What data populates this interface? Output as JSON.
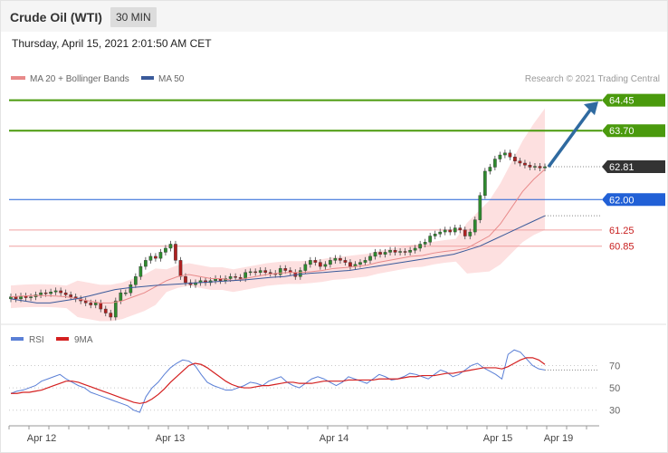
{
  "header": {
    "title": "Crude Oil (WTI)",
    "timeframe": "30 MIN",
    "date": "Thursday, April 15, 2021 2:01:50 AM CET"
  },
  "legend": {
    "ma20": "MA 20 + Bollinger Bands",
    "ma50": "MA 50",
    "copyright": "Research © 2021 Trading Central"
  },
  "colors": {
    "green": "#4a9a0d",
    "blue": "#2160d6",
    "red_line": "#f0a0a0",
    "red_text": "#c81e1e",
    "ma20": "#e88a8a",
    "ma50": "#3a5a9a",
    "band": "#fde0e0",
    "rsi": "#5a7fd6",
    "rsi_ma": "#d42020",
    "arrow": "#2f6aa0"
  },
  "chart_data": [
    {
      "type": "line",
      "title": "",
      "x_ticks": [
        "Apr 12",
        "Apr 13",
        "Apr 14",
        "Apr 15",
        "Apr 19"
      ],
      "ylim": [
        59.1,
        64.8
      ],
      "levels": [
        {
          "value": 64.45,
          "label": "64.45",
          "style": "resistance"
        },
        {
          "value": 63.7,
          "label": "63.70",
          "style": "resistance"
        },
        {
          "value": 62.81,
          "label": "62.81",
          "style": "last-price"
        },
        {
          "value": 62.0,
          "label": "62.00",
          "style": "pivot"
        },
        {
          "value": 61.25,
          "label": "61.25",
          "style": "support"
        },
        {
          "value": 60.85,
          "label": "60.85",
          "style": "support"
        }
      ],
      "price_close": [
        59.6,
        59.55,
        59.62,
        59.58,
        59.6,
        59.65,
        59.7,
        59.68,
        59.72,
        59.75,
        59.7,
        59.65,
        59.6,
        59.55,
        59.5,
        59.45,
        59.4,
        59.45,
        59.3,
        59.2,
        59.1,
        59.5,
        59.7,
        59.7,
        59.9,
        60.1,
        60.35,
        60.5,
        60.6,
        60.55,
        60.7,
        60.8,
        60.9,
        60.5,
        60.1,
        59.95,
        59.9,
        59.95,
        60.0,
        59.95,
        60.0,
        60.05,
        60.0,
        60.05,
        60.1,
        60.08,
        60.05,
        60.2,
        60.22,
        60.2,
        60.25,
        60.2,
        60.18,
        60.15,
        60.3,
        60.25,
        60.2,
        60.1,
        60.25,
        60.4,
        60.5,
        60.45,
        60.35,
        60.4,
        60.5,
        60.55,
        60.5,
        60.45,
        60.35,
        60.4,
        60.45,
        60.5,
        60.6,
        60.7,
        60.65,
        60.7,
        60.75,
        60.7,
        60.72,
        60.7,
        60.75,
        60.8,
        60.9,
        60.95,
        61.1,
        61.15,
        61.2,
        61.25,
        61.2,
        61.3,
        61.25,
        61.1,
        61.2,
        61.5,
        62.1,
        62.7,
        62.8,
        63.0,
        63.1,
        63.15,
        63.05,
        62.95,
        62.9,
        62.85,
        62.8,
        62.82,
        62.78,
        62.81
      ],
      "ma20": [
        59.6,
        59.62,
        59.63,
        59.63,
        59.62,
        59.6,
        59.55,
        59.5,
        59.45,
        59.45,
        59.5,
        59.6,
        59.7,
        59.85,
        60.0,
        60.1,
        60.15,
        60.1,
        60.05,
        60.05,
        60.0,
        60.05,
        60.1,
        60.15,
        60.18,
        60.2,
        60.2,
        60.22,
        60.25,
        60.3,
        60.32,
        60.35,
        60.38,
        60.45,
        60.5,
        60.55,
        60.6,
        60.62,
        60.68,
        60.72,
        60.75,
        60.8,
        60.95,
        61.1,
        61.4,
        61.8,
        62.2,
        62.5,
        62.75
      ],
      "ma50": [
        59.55,
        59.5,
        59.45,
        59.45,
        59.5,
        59.55,
        59.62,
        59.7,
        59.78,
        59.82,
        59.85,
        59.88,
        59.9,
        59.92,
        59.94,
        59.96,
        59.98,
        60.0,
        60.02,
        60.05,
        60.08,
        60.1,
        60.15,
        60.18,
        60.2,
        60.23,
        60.25,
        60.3,
        60.35,
        60.4,
        60.45,
        60.5,
        60.55,
        60.6,
        60.65,
        60.75,
        60.85,
        61.0,
        61.15,
        61.3,
        61.45,
        61.6
      ]
    },
    {
      "type": "line",
      "title": "RSI",
      "ylim": [
        20,
        85
      ],
      "y_ticks": [
        "70",
        "50",
        "30"
      ],
      "series": [
        {
          "name": "RSI",
          "values": [
            45,
            47,
            48,
            50,
            52,
            56,
            58,
            60,
            62,
            58,
            55,
            52,
            50,
            46,
            44,
            42,
            40,
            38,
            36,
            34,
            30,
            28,
            42,
            50,
            55,
            62,
            68,
            72,
            75,
            74,
            70,
            62,
            55,
            52,
            50,
            48,
            48,
            50,
            52,
            55,
            54,
            52,
            56,
            58,
            60,
            55,
            52,
            50,
            54,
            58,
            60,
            58,
            55,
            52,
            55,
            60,
            58,
            56,
            54,
            58,
            62,
            60,
            57,
            58,
            60,
            63,
            62,
            60,
            58,
            62,
            66,
            64,
            60,
            62,
            66,
            70,
            72,
            68,
            65,
            62,
            58,
            80,
            84,
            82,
            76,
            70,
            67,
            66
          ]
        },
        {
          "name": "9MA",
          "values": [
            45,
            45,
            46,
            46,
            47,
            48,
            50,
            52,
            54,
            56,
            56,
            55,
            53,
            51,
            49,
            47,
            45,
            43,
            41,
            39,
            37,
            36,
            37,
            40,
            44,
            49,
            55,
            60,
            65,
            70,
            72,
            71,
            68,
            64,
            60,
            56,
            53,
            51,
            50,
            50,
            51,
            52,
            52,
            53,
            54,
            55,
            55,
            54,
            54,
            54,
            55,
            56,
            56,
            56,
            56,
            57,
            57,
            57,
            57,
            57,
            58,
            58,
            58,
            58,
            59,
            60,
            60,
            61,
            61,
            61,
            62,
            63,
            63,
            64,
            65,
            66,
            67,
            68,
            68,
            68,
            67,
            69,
            72,
            75,
            77,
            77,
            75,
            71
          ]
        }
      ]
    }
  ]
}
